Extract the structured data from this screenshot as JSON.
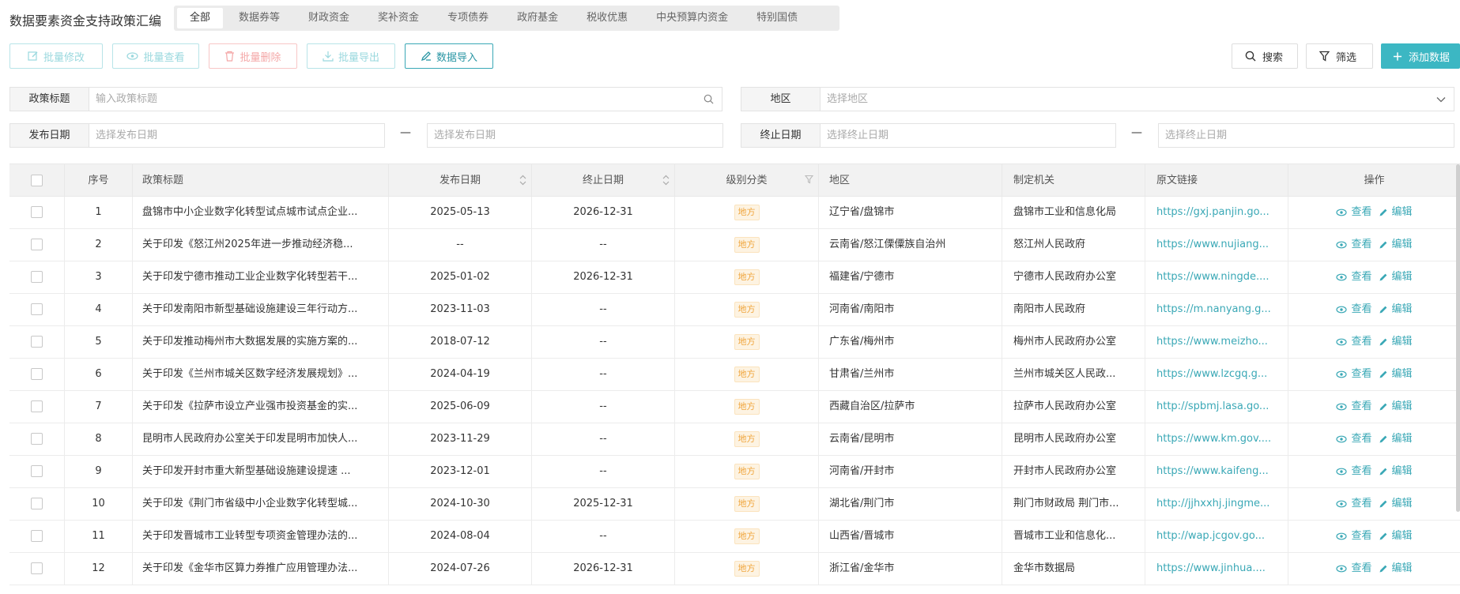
{
  "header": {
    "title": "数据要素资金支持政策汇编",
    "tabs": [
      "全部",
      "数据券等",
      "财政资金",
      "奖补资金",
      "专项债券",
      "政府基金",
      "税收优惠",
      "中央预算内资金",
      "特别国债"
    ]
  },
  "toolbar": {
    "batch_edit": "批量修改",
    "batch_view": "批量查看",
    "batch_delete": "批量删除",
    "batch_export": "批量导出",
    "data_import": "数据导入",
    "search": "搜索",
    "filter": "筛选",
    "add_data": "添加数据"
  },
  "filters": {
    "policy_title_label": "政策标题",
    "policy_title_placeholder": "输入政策标题",
    "region_label": "地区",
    "region_placeholder": "选择地区",
    "publish_date_label": "发布日期",
    "publish_date_placeholder_start": "选择发布日期",
    "publish_date_placeholder_end": "选择发布日期",
    "end_date_label": "终止日期",
    "end_date_placeholder_start": "选择终止日期",
    "end_date_placeholder_end": "选择终止日期",
    "range_separator": "—"
  },
  "table": {
    "columns": [
      "序号",
      "政策标题",
      "发布日期",
      "终止日期",
      "级别分类",
      "地区",
      "制定机关",
      "原文链接",
      "操作"
    ],
    "view_label": "查看",
    "edit_label": "编辑",
    "rows": [
      {
        "no": "1",
        "title": "盘锦市中小企业数字化转型试点城市试点企业...",
        "pub": "2025-05-13",
        "end": "2026-12-31",
        "level": "地方",
        "area": "辽宁省/盘锦市",
        "org": "盘锦市工业和信息化局",
        "link": "https://gxj.panjin.go..."
      },
      {
        "no": "2",
        "title": "关于印发《怒江州2025年进一步推动经济稳...",
        "pub": "--",
        "end": "--",
        "level": "地方",
        "area": "云南省/怒江傈僳族自治州",
        "org": "怒江州人民政府",
        "link": "https://www.nujiang..."
      },
      {
        "no": "3",
        "title": "关于印发宁德市推动工业企业数字化转型若干...",
        "pub": "2025-01-02",
        "end": "2026-12-31",
        "level": "地方",
        "area": "福建省/宁德市",
        "org": "宁德市人民政府办公室",
        "link": "https://www.ningde...."
      },
      {
        "no": "4",
        "title": "关于印发南阳市新型基础设施建设三年行动方...",
        "pub": "2023-11-03",
        "end": "--",
        "level": "地方",
        "area": "河南省/南阳市",
        "org": "南阳市人民政府",
        "link": "https://m.nanyang.g..."
      },
      {
        "no": "5",
        "title": "关于印发推动梅州市大数据发展的实施方案的...",
        "pub": "2018-07-12",
        "end": "--",
        "level": "地方",
        "area": "广东省/梅州市",
        "org": "梅州市人民政府办公室",
        "link": "https://www.meizho..."
      },
      {
        "no": "6",
        "title": "关于印发《兰州市城关区数字经济发展规划》...",
        "pub": "2024-04-19",
        "end": "--",
        "level": "地方",
        "area": "甘肃省/兰州市",
        "org": "兰州市城关区人民政...",
        "link": "https://www.lzcgq.g..."
      },
      {
        "no": "7",
        "title": "关于印发《拉萨市设立产业强市投资基金的实...",
        "pub": "2025-06-09",
        "end": "--",
        "level": "地方",
        "area": "西藏自治区/拉萨市",
        "org": "拉萨市人民政府办公室",
        "link": "http://spbmj.lasa.go..."
      },
      {
        "no": "8",
        "title": "昆明市人民政府办公室关于印发昆明市加快人...",
        "pub": "2023-11-29",
        "end": "--",
        "level": "地方",
        "area": "云南省/昆明市",
        "org": "昆明市人民政府办公室",
        "link": "https://www.km.gov...."
      },
      {
        "no": "9",
        "title": "关于印发开封市重大新型基础设施建设提速 ...",
        "pub": "2023-12-01",
        "end": "--",
        "level": "地方",
        "area": "河南省/开封市",
        "org": "开封市人民政府办公室",
        "link": "https://www.kaifeng..."
      },
      {
        "no": "10",
        "title": "关于印发《荆门市省级中小企业数字化转型城...",
        "pub": "2024-10-30",
        "end": "2025-12-31",
        "level": "地方",
        "area": "湖北省/荆门市",
        "org": "荆门市财政局 荆门市...",
        "link": "http://jjhxxhj.jingme..."
      },
      {
        "no": "11",
        "title": "关于印发晋城市工业转型专项资金管理办法的...",
        "pub": "2024-08-04",
        "end": "--",
        "level": "地方",
        "area": "山西省/晋城市",
        "org": "晋城市工业和信息化...",
        "link": "http://wap.jcgov.go..."
      },
      {
        "no": "12",
        "title": "关于印发《金华市区算力券推广应用管理办法...",
        "pub": "2024-07-26",
        "end": "2026-12-31",
        "level": "地方",
        "area": "浙江省/金华市",
        "org": "金华市数据局",
        "link": "https://www.jinhua...."
      }
    ]
  }
}
